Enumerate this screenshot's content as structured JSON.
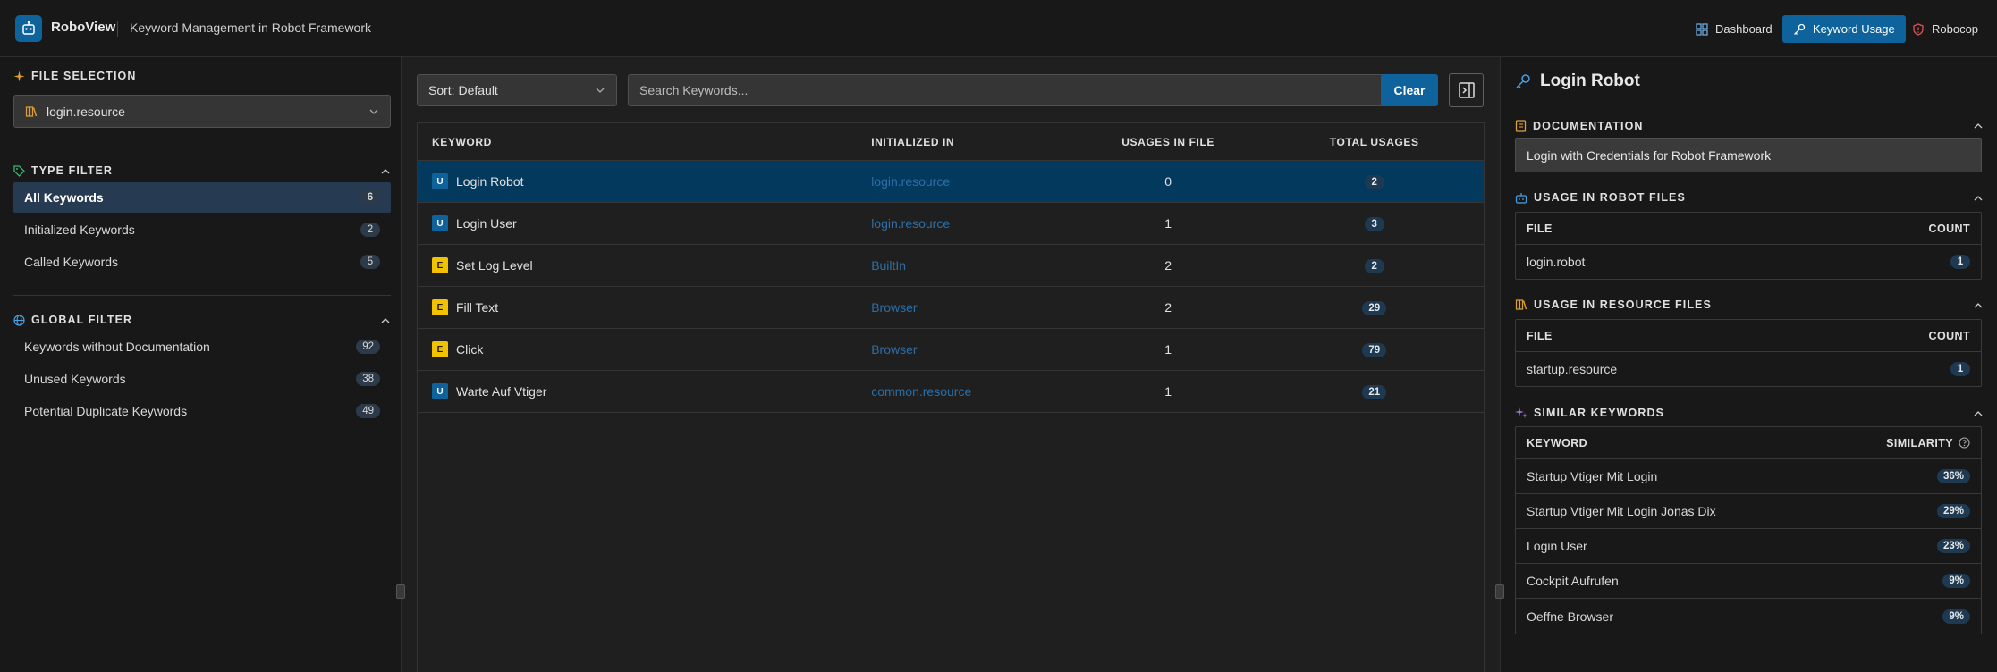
{
  "header": {
    "brand": "RoboView",
    "subtitle": "Keyword Management in Robot Framework",
    "nav": [
      {
        "label": "Dashboard",
        "icon": "grid-icon",
        "active": false
      },
      {
        "label": "Keyword Usage",
        "icon": "key-icon",
        "active": true
      },
      {
        "label": "Robocop",
        "icon": "shield-icon",
        "active": false
      }
    ]
  },
  "sidebar": {
    "file_selection": {
      "title": "FILE SELECTION",
      "selected_file": "login.resource"
    },
    "type_filter": {
      "title": "TYPE FILTER",
      "items": [
        {
          "label": "All Keywords",
          "count": "6",
          "active": true
        },
        {
          "label": "Initialized Keywords",
          "count": "2",
          "active": false
        },
        {
          "label": "Called Keywords",
          "count": "5",
          "active": false
        }
      ]
    },
    "global_filter": {
      "title": "GLOBAL FILTER",
      "items": [
        {
          "label": "Keywords without Documentation",
          "count": "92"
        },
        {
          "label": "Unused Keywords",
          "count": "38"
        },
        {
          "label": "Potential Duplicate Keywords",
          "count": "49"
        }
      ]
    }
  },
  "toolbar": {
    "sort_label": "Sort: Default",
    "search_placeholder": "Search Keywords...",
    "clear_label": "Clear"
  },
  "keyword_table": {
    "headers": [
      "KEYWORD",
      "INITIALIZED IN",
      "USAGES IN FILE",
      "TOTAL USAGES"
    ],
    "rows": [
      {
        "type": "U",
        "keyword": "Login Robot",
        "initialized_in": "login.resource",
        "usages_in_file": "0",
        "total_usages": "2",
        "selected": true
      },
      {
        "type": "U",
        "keyword": "Login User",
        "initialized_in": "login.resource",
        "usages_in_file": "1",
        "total_usages": "3",
        "selected": false
      },
      {
        "type": "E",
        "keyword": "Set Log Level",
        "initialized_in": "BuiltIn",
        "usages_in_file": "2",
        "total_usages": "2",
        "selected": false
      },
      {
        "type": "E",
        "keyword": "Fill Text",
        "initialized_in": "Browser",
        "usages_in_file": "2",
        "total_usages": "29",
        "selected": false
      },
      {
        "type": "E",
        "keyword": "Click",
        "initialized_in": "Browser",
        "usages_in_file": "1",
        "total_usages": "79",
        "selected": false
      },
      {
        "type": "U",
        "keyword": "Warte Auf Vtiger",
        "initialized_in": "common.resource",
        "usages_in_file": "1",
        "total_usages": "21",
        "selected": false
      }
    ]
  },
  "detail": {
    "title": "Login Robot",
    "documentation": {
      "title": "DOCUMENTATION",
      "text": "Login with Credentials for Robot Framework"
    },
    "robot_files": {
      "title": "USAGE IN ROBOT FILES",
      "headers": [
        "FILE",
        "COUNT"
      ],
      "rows": [
        {
          "file": "login.robot",
          "count": "1"
        }
      ]
    },
    "resource_files": {
      "title": "USAGE IN RESOURCE FILES",
      "headers": [
        "FILE",
        "COUNT"
      ],
      "rows": [
        {
          "file": "startup.resource",
          "count": "1"
        }
      ]
    },
    "similar": {
      "title": "SIMILAR KEYWORDS",
      "headers": [
        "KEYWORD",
        "SIMILARITY"
      ],
      "rows": [
        {
          "keyword": "Startup Vtiger Mit Login",
          "similarity": "36%"
        },
        {
          "keyword": "Startup Vtiger Mit Login Jonas Dix",
          "similarity": "29%"
        },
        {
          "keyword": "Login User",
          "similarity": "23%"
        },
        {
          "keyword": "Cockpit Aufrufen",
          "similarity": "9%"
        },
        {
          "keyword": "Oeffne Browser",
          "similarity": "9%"
        }
      ]
    }
  },
  "colors": {
    "accent": "#0e639c",
    "selected_row": "#04395e",
    "link": "#2c6fa8",
    "user_badge": "#0e639c",
    "external_badge": "#f2c200"
  }
}
